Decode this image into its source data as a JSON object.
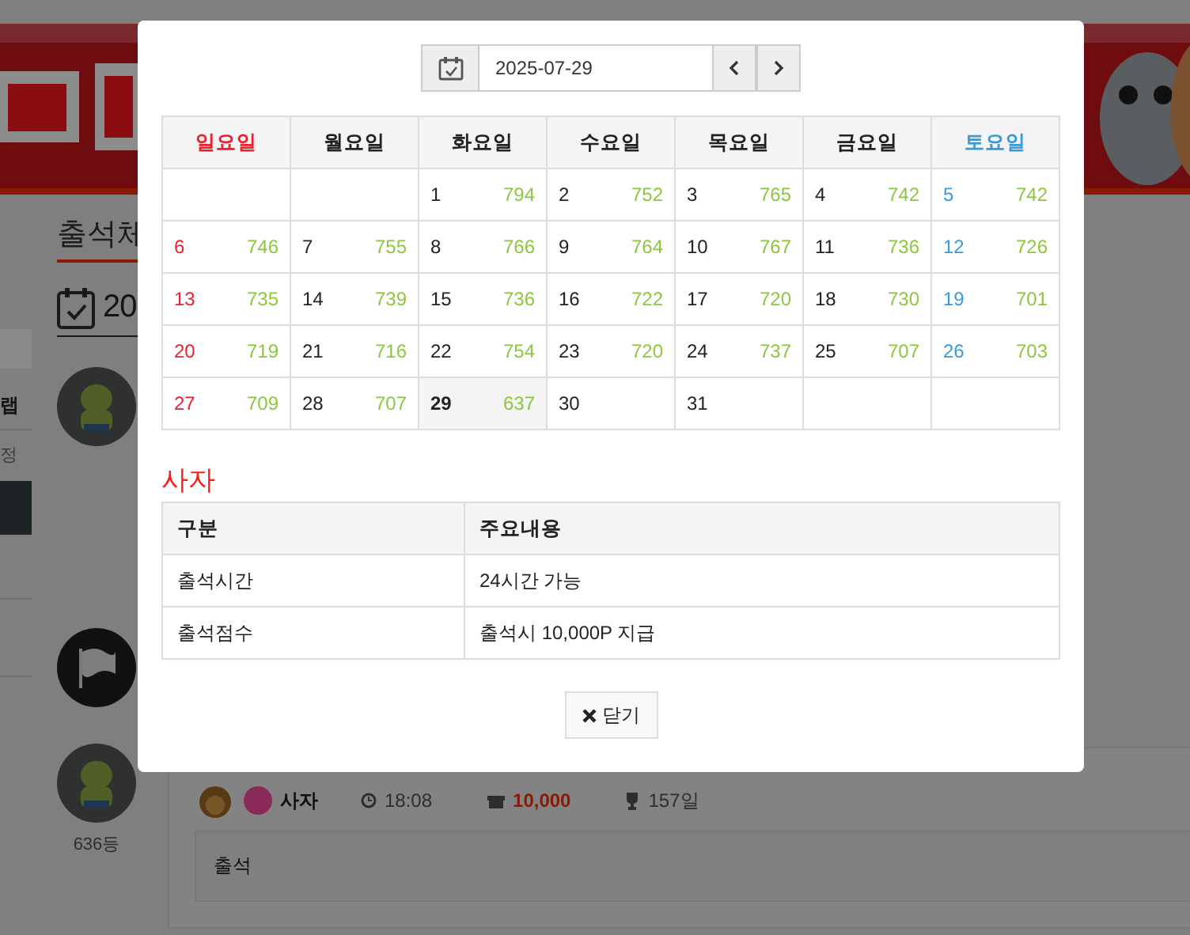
{
  "background": {
    "section_title": "출석체",
    "date_heading": "20",
    "side_texts": [
      "랩",
      "정"
    ],
    "entries": [
      {
        "kind": "character"
      },
      {
        "kind": "flag"
      },
      {
        "kind": "character",
        "rank": "636등"
      }
    ],
    "latest": {
      "name": "사자",
      "time": "18:08",
      "points": "10,000",
      "days": "157일",
      "comment": "출석"
    }
  },
  "modal": {
    "date": "2025-07-29",
    "weekdays": [
      "일요일",
      "월요일",
      "화요일",
      "수요일",
      "목요일",
      "금요일",
      "토요일"
    ],
    "weeks": [
      [
        {
          "kind": "blank"
        },
        {
          "kind": "blank"
        },
        {
          "kind": "day",
          "day": "1",
          "points": "794",
          "selected": false
        },
        {
          "kind": "day",
          "day": "2",
          "points": "752",
          "selected": false
        },
        {
          "kind": "day",
          "day": "3",
          "points": "765",
          "selected": false
        },
        {
          "kind": "day",
          "day": "4",
          "points": "742",
          "selected": false
        },
        {
          "kind": "day",
          "day": "5",
          "points": "742",
          "selected": false
        }
      ],
      [
        {
          "kind": "day",
          "day": "6",
          "points": "746",
          "selected": false
        },
        {
          "kind": "day",
          "day": "7",
          "points": "755",
          "selected": false
        },
        {
          "kind": "day",
          "day": "8",
          "points": "766",
          "selected": false
        },
        {
          "kind": "day",
          "day": "9",
          "points": "764",
          "selected": false
        },
        {
          "kind": "day",
          "day": "10",
          "points": "767",
          "selected": false
        },
        {
          "kind": "day",
          "day": "11",
          "points": "736",
          "selected": false
        },
        {
          "kind": "day",
          "day": "12",
          "points": "726",
          "selected": false
        }
      ],
      [
        {
          "kind": "day",
          "day": "13",
          "points": "735",
          "selected": false
        },
        {
          "kind": "day",
          "day": "14",
          "points": "739",
          "selected": false
        },
        {
          "kind": "day",
          "day": "15",
          "points": "736",
          "selected": false
        },
        {
          "kind": "day",
          "day": "16",
          "points": "722",
          "selected": false
        },
        {
          "kind": "day",
          "day": "17",
          "points": "720",
          "selected": false
        },
        {
          "kind": "day",
          "day": "18",
          "points": "730",
          "selected": false
        },
        {
          "kind": "day",
          "day": "19",
          "points": "701",
          "selected": false
        }
      ],
      [
        {
          "kind": "day",
          "day": "20",
          "points": "719",
          "selected": false
        },
        {
          "kind": "day",
          "day": "21",
          "points": "716",
          "selected": false
        },
        {
          "kind": "day",
          "day": "22",
          "points": "754",
          "selected": false
        },
        {
          "kind": "day",
          "day": "23",
          "points": "720",
          "selected": false
        },
        {
          "kind": "day",
          "day": "24",
          "points": "737",
          "selected": false
        },
        {
          "kind": "day",
          "day": "25",
          "points": "707",
          "selected": false
        },
        {
          "kind": "day",
          "day": "26",
          "points": "703",
          "selected": false
        }
      ],
      [
        {
          "kind": "day",
          "day": "27",
          "points": "709",
          "selected": false
        },
        {
          "kind": "day",
          "day": "28",
          "points": "707",
          "selected": false
        },
        {
          "kind": "day",
          "day": "29",
          "points": "637",
          "selected": true
        },
        {
          "kind": "day",
          "day": "30",
          "selected": false
        },
        {
          "kind": "day",
          "day": "31",
          "selected": false
        },
        {
          "kind": "blank"
        },
        {
          "kind": "blank"
        }
      ]
    ],
    "title": "사자",
    "info": {
      "columns": [
        "구분",
        "주요내용"
      ],
      "rows": [
        [
          "출석시간",
          "24시간 가능"
        ],
        [
          "출석점수",
          "출석시 10,000P 지급"
        ]
      ]
    },
    "close_button": "닫기"
  }
}
